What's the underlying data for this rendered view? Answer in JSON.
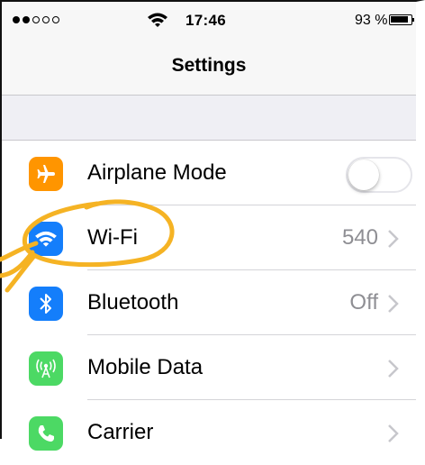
{
  "status_bar": {
    "signal_bars_filled": 2,
    "signal_bars_total": 5,
    "time": "17:46",
    "battery_percent_text": "93 %",
    "battery_level": 0.93
  },
  "nav": {
    "title": "Settings"
  },
  "settings": [
    {
      "label": "Airplane Mode",
      "icon": "airplane-icon",
      "color": "#ff9500",
      "toggle": false
    },
    {
      "label": "Wi-Fi",
      "icon": "wifi-icon",
      "color": "#147efb",
      "value": "540"
    },
    {
      "label": "Bluetooth",
      "icon": "bluetooth-icon",
      "color": "#147efb",
      "value": "Off"
    },
    {
      "label": "Mobile Data",
      "icon": "antenna-icon",
      "color": "#4cd964",
      "value": ""
    },
    {
      "label": "Carrier",
      "icon": "phone-icon",
      "color": "#4cd964",
      "value": ""
    }
  ],
  "colors": {
    "annotation": "#f5b324",
    "chevron": "#c7c7cc",
    "value_text": "#8e8e93"
  }
}
